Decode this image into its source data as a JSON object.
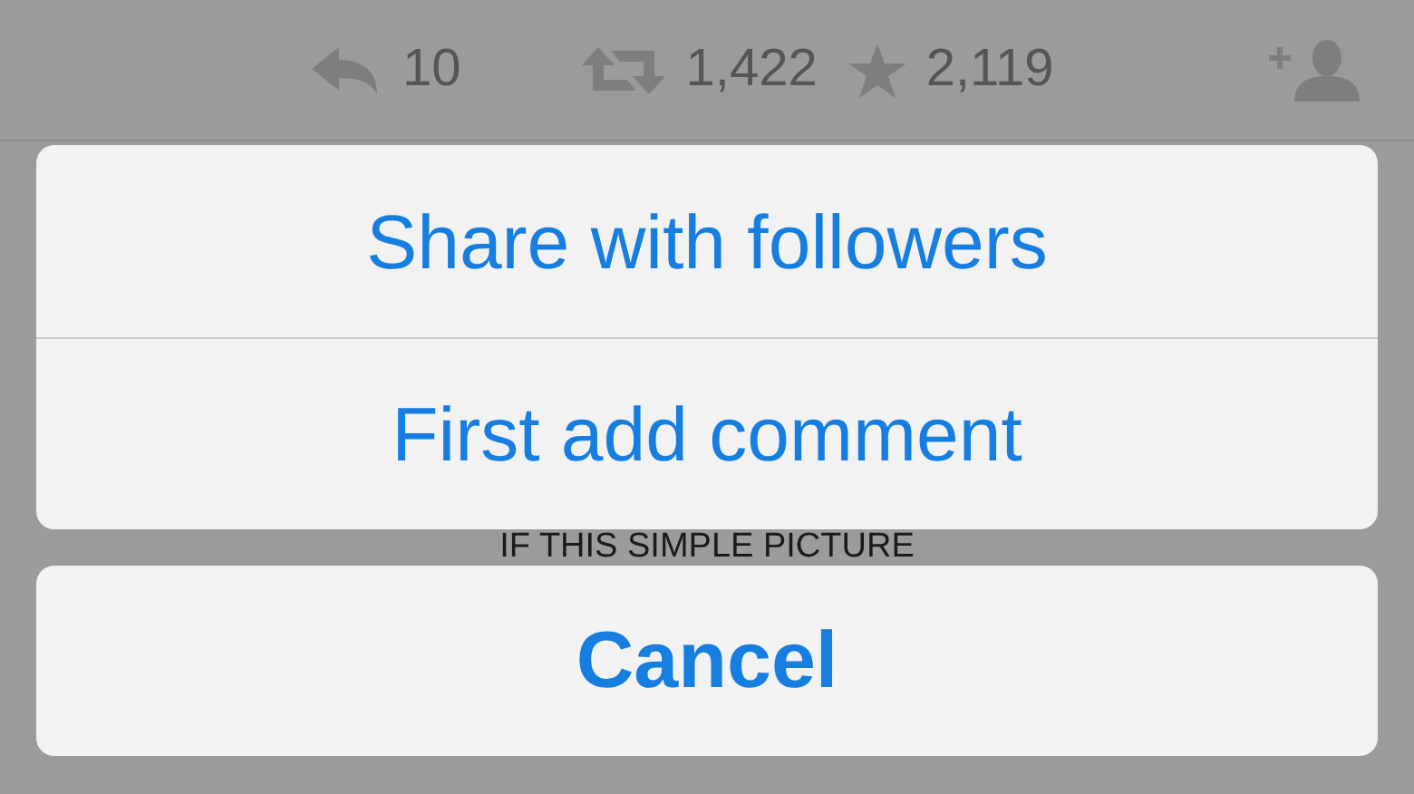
{
  "tweet_actions": {
    "reply_count": "10",
    "retweet_count": "1,422",
    "favorite_count": "2,119"
  },
  "action_sheet": {
    "options": [
      {
        "label": "Share with followers"
      },
      {
        "label": "First add comment"
      }
    ],
    "cancel": "Cancel"
  },
  "tweet_text": "IF THIS SIMPLE PICTURE"
}
